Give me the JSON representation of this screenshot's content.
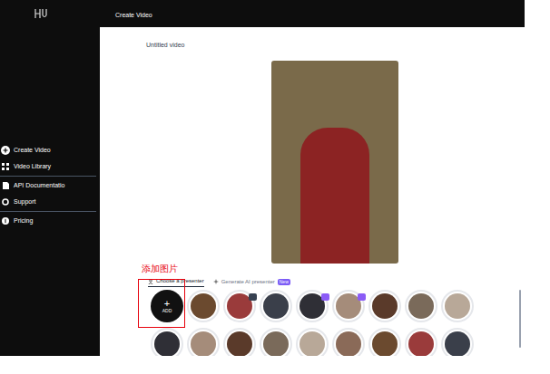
{
  "window": {
    "title": "Create Video"
  },
  "sidebar": {
    "items": [
      {
        "label": "Create Video",
        "icon": "plus",
        "separator_after": false
      },
      {
        "label": "Video Library",
        "icon": "grid",
        "separator_after": true
      },
      {
        "label": "API Documentatio",
        "icon": "doc",
        "separator_after": false
      },
      {
        "label": "Support",
        "icon": "support",
        "separator_after": true
      },
      {
        "label": "Pricing",
        "icon": "price",
        "separator_after": false
      }
    ]
  },
  "editor": {
    "video_title": "Untitled video"
  },
  "annotation": {
    "label": "添加图片"
  },
  "tabs": [
    {
      "label": "Choose a presenter",
      "selected": true,
      "badge": ""
    },
    {
      "label": "Generate AI presenter",
      "selected": false,
      "badge": "New"
    }
  ],
  "add_button": {
    "symbol": "+",
    "label": "ADD"
  },
  "avatars": [
    [
      {
        "badge": false,
        "badge_color": ""
      },
      {
        "badge": true,
        "badge_color": "#374151"
      },
      {
        "badge": false,
        "badge_color": ""
      },
      {
        "badge": true,
        "badge_color": "#8b5cf6"
      },
      {
        "badge": true,
        "badge_color": "#8b5cf6"
      },
      {
        "badge": false,
        "badge_color": ""
      },
      {
        "badge": false,
        "badge_color": ""
      },
      {
        "badge": false,
        "badge_color": ""
      }
    ],
    [
      {
        "badge": false,
        "badge_color": ""
      },
      {
        "badge": false,
        "badge_color": ""
      },
      {
        "badge": false,
        "badge_color": ""
      },
      {
        "badge": false,
        "badge_color": ""
      },
      {
        "badge": false,
        "badge_color": ""
      },
      {
        "badge": false,
        "badge_color": ""
      },
      {
        "badge": false,
        "badge_color": ""
      },
      {
        "badge": false,
        "badge_color": ""
      },
      {
        "badge": false,
        "badge_color": ""
      }
    ]
  ]
}
